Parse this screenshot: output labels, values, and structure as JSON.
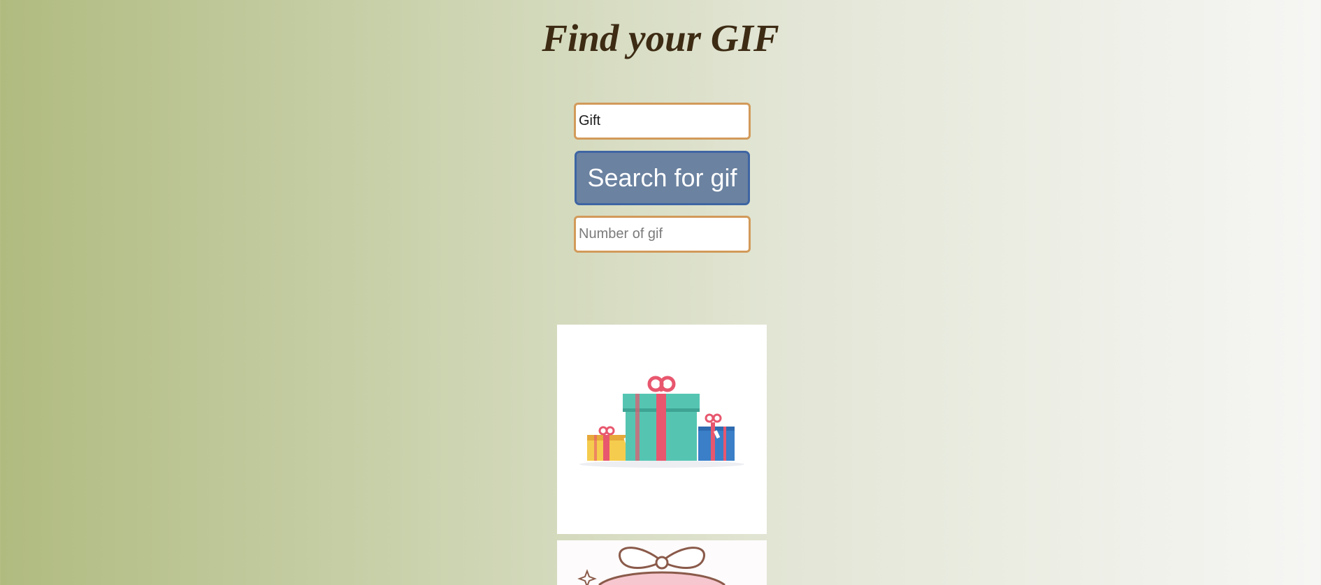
{
  "header": {
    "title": "Find your GIF"
  },
  "search": {
    "query_value": "Gift",
    "button_label": "Search for gif",
    "count_placeholder": "Number of gif",
    "count_value": ""
  },
  "results": {
    "items": [
      {
        "icon": "gift-boxes-gif",
        "alt": ""
      },
      {
        "icon": "gift-bow-gif",
        "alt": ""
      }
    ]
  },
  "colors": {
    "title": "#3d2b14",
    "input_border": "#d29a5a",
    "button_bg": "#6b82a0",
    "button_border": "#3e65a3",
    "gradient_left": "#b0bb80",
    "gradient_right": "#f6f6f4"
  }
}
